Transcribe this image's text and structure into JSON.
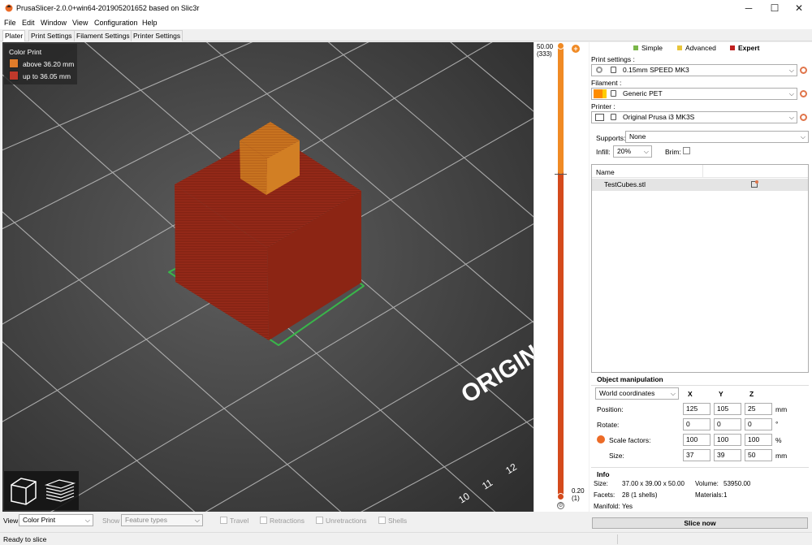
{
  "window": {
    "title": "PrusaSlicer-2.0.0+win64-201905201652 based on Slic3r",
    "minimize_glyph": "─",
    "maximize_glyph": "☐",
    "close_glyph": "✕"
  },
  "menu": [
    "File",
    "Edit",
    "Window",
    "View",
    "Configuration",
    "Help"
  ],
  "tabs": [
    "Plater",
    "Print Settings",
    "Filament Settings",
    "Printer Settings"
  ],
  "legend": {
    "title": "Color Print",
    "items": [
      {
        "label": "above 36.20 mm",
        "color": "#e07c2a"
      },
      {
        "label": "up to 36.05 mm",
        "color": "#c0392b"
      }
    ]
  },
  "bed_text": {
    "origin": "ORIGIN",
    "ticks": [
      "10",
      "11",
      "12"
    ]
  },
  "slider": {
    "top_value": "50.00",
    "top_layer": "(333)",
    "bottom_value": "0.20",
    "bottom_layer": "(1)",
    "top_fraction": 0.719,
    "top_color": "#f08a24",
    "bottom_color": "#d44a1c"
  },
  "modes": [
    {
      "label": "Simple",
      "color": "#7ab648"
    },
    {
      "label": "Advanced",
      "color": "#e8c53a"
    },
    {
      "label": "Expert",
      "color": "#c0211f"
    }
  ],
  "settings": {
    "print_label": "Print settings :",
    "print_value": "0.15mm SPEED MK3",
    "filament_label": "Filament :",
    "filament_value": "Generic PET",
    "filament_color": "#ff8c00",
    "printer_label": "Printer :",
    "printer_value": "Original Prusa i3 MK3S",
    "supports_label": "Supports:",
    "supports_value": "None",
    "infill_label": "Infill:",
    "infill_value": "20%",
    "brim_label": "Brim:"
  },
  "objects": {
    "header_name": "Name",
    "rows": [
      "TestCubes.stl"
    ]
  },
  "manipulation": {
    "title": "Object manipulation",
    "coords": "World coordinates",
    "axes": [
      "X",
      "Y",
      "Z"
    ],
    "rows": [
      {
        "label": "Position:",
        "values": [
          "125",
          "105",
          "25"
        ],
        "unit": "mm"
      },
      {
        "label": "Rotate:",
        "values": [
          "0",
          "0",
          "0"
        ],
        "unit": "°"
      },
      {
        "label": "Scale factors:",
        "values": [
          "100",
          "100",
          "100"
        ],
        "unit": "%"
      },
      {
        "label": "Size:",
        "values": [
          "37",
          "39",
          "50"
        ],
        "unit": "mm"
      }
    ]
  },
  "info": {
    "title": "Info",
    "size_label": "Size:",
    "size_value": "37.00 x 39.00 x 50.00",
    "volume_label": "Volume:",
    "volume_value": "53950.00",
    "facets_label": "Facets:",
    "facets_value": "28 (1 shells)",
    "materials_label": "Materials:",
    "materials_value": "1",
    "manifold_label": "Manifold:",
    "manifold_value": "Yes"
  },
  "bottom": {
    "view_label": "View",
    "view_value": "Color Print",
    "show_label": "Show",
    "show_value": "Feature types",
    "options": [
      "Travel",
      "Retractions",
      "Unretractions",
      "Shells"
    ]
  },
  "slice_button": "Slice now",
  "status": "Ready to slice"
}
